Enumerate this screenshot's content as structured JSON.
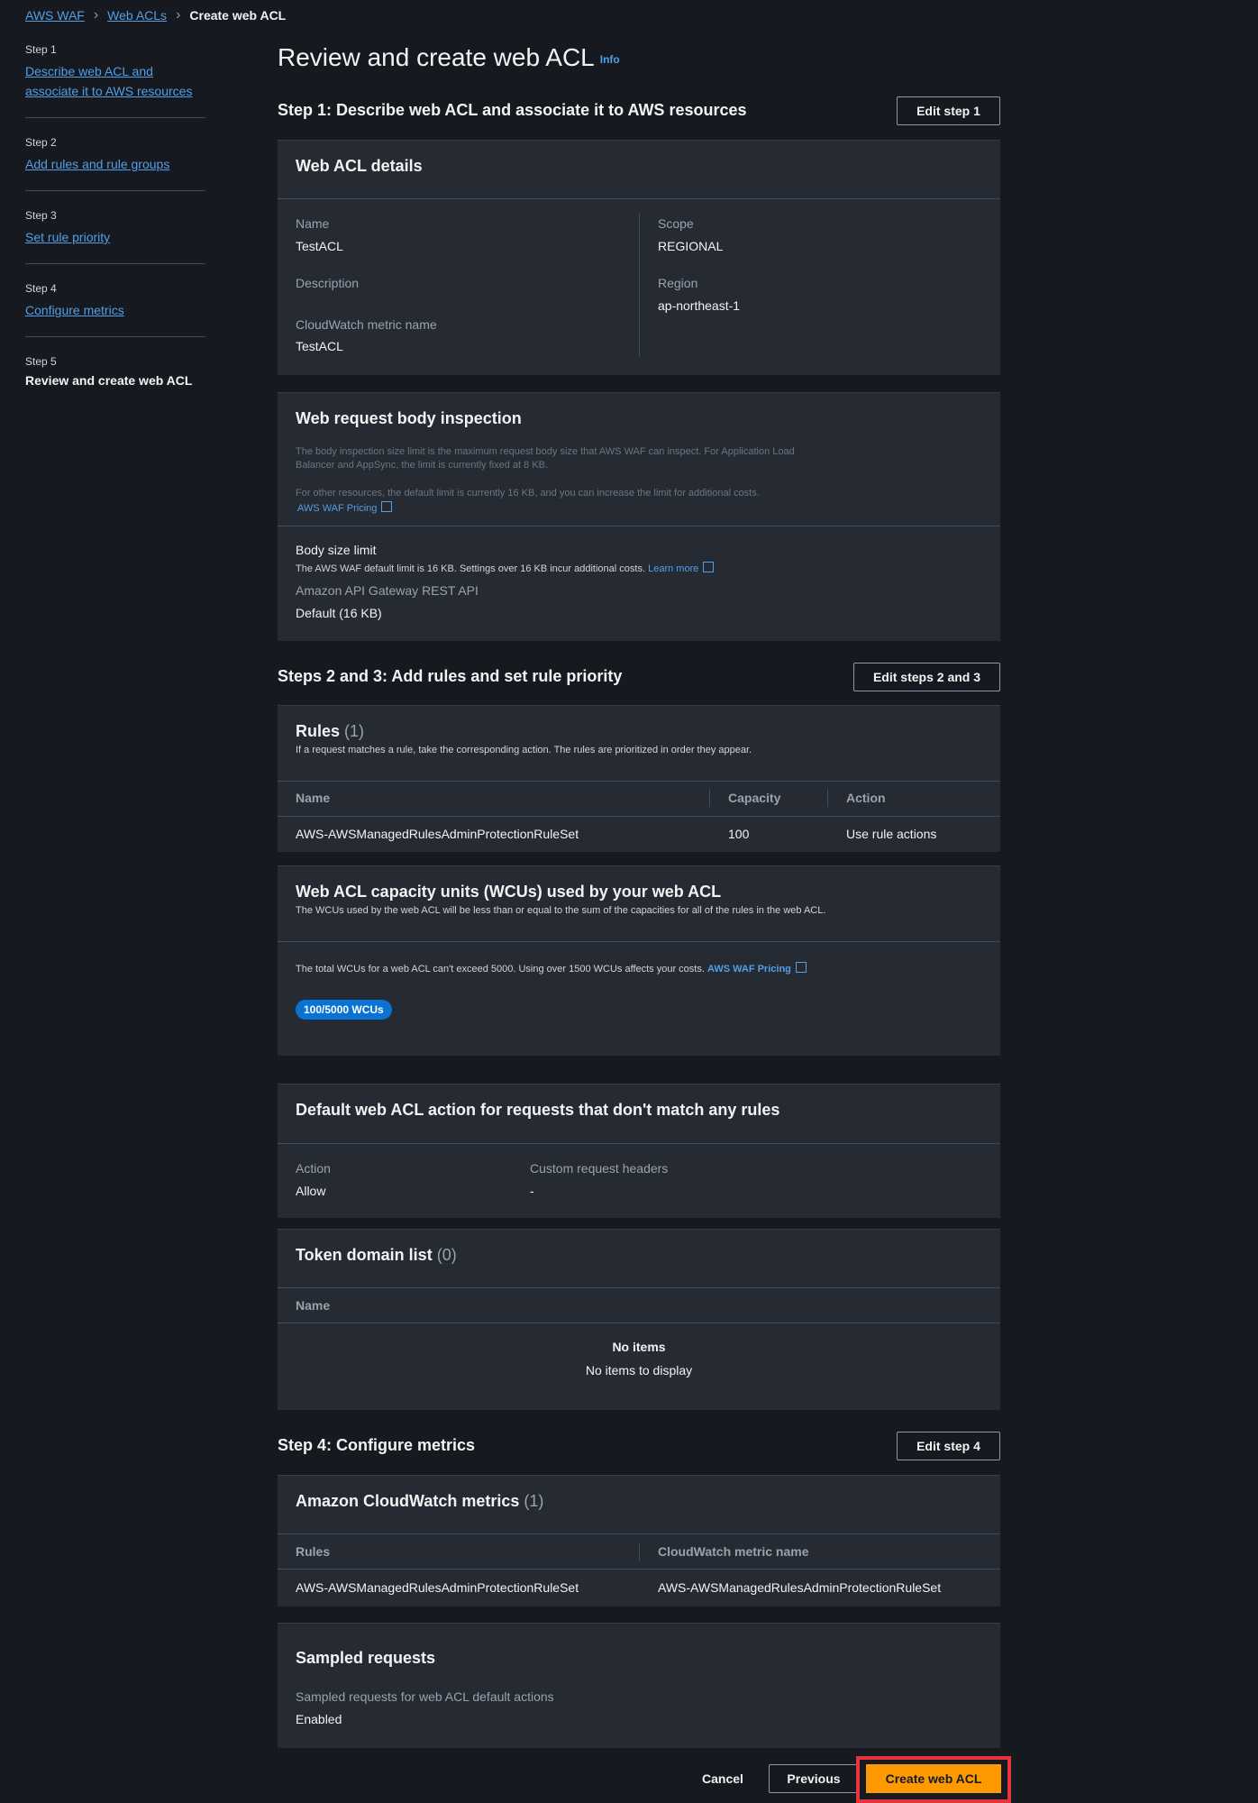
{
  "breadcrumb": {
    "items": [
      "AWS WAF",
      "Web ACLs"
    ],
    "current": "Create web ACL"
  },
  "nav": {
    "steps": [
      {
        "num": "Step 1",
        "label": "Describe web ACL and associate it to AWS resources"
      },
      {
        "num": "Step 2",
        "label": "Add rules and rule groups"
      },
      {
        "num": "Step 3",
        "label": "Set rule priority"
      },
      {
        "num": "Step 4",
        "label": "Configure metrics"
      },
      {
        "num": "Step 5",
        "label": "Review and create web ACL"
      }
    ]
  },
  "page": {
    "title": "Review and create web ACL",
    "info": "Info"
  },
  "step1": {
    "title": "Step 1: Describe web ACL and associate it to AWS resources",
    "edit_label": "Edit step 1",
    "details": {
      "title": "Web ACL details",
      "name_label": "Name",
      "name_value": "TestACL",
      "description_label": "Description",
      "metric_label": "CloudWatch metric name",
      "metric_value": "TestACL",
      "scope_label": "Scope",
      "scope_value": "REGIONAL",
      "region_label": "Region",
      "region_value": "ap-northeast-1"
    },
    "body": {
      "title": "Web request body inspection",
      "desc1": "The body inspection size limit is the maximum request body size that AWS WAF can inspect. For Application Load Balancer and AppSync, the limit is currently fixed at 8 KB.",
      "desc2": "For other resources, the default limit is currently 16 KB, and you can increase the limit for additional costs.",
      "pricing_link": "AWS WAF Pricing",
      "size_label": "Body size limit",
      "size_desc": "The AWS WAF default limit is 16 KB. Settings over 16 KB incur additional costs.",
      "learn_more": "Learn more",
      "api_label": "Amazon API Gateway REST API",
      "api_value": "Default (16 KB)"
    }
  },
  "steps23": {
    "title": "Steps 2 and 3: Add rules and set rule priority",
    "edit_label": "Edit steps 2 and 3",
    "rules": {
      "title": "Rules",
      "count": "(1)",
      "desc": "If a request matches a rule, take the corresponding action. The rules are prioritized in order they appear.",
      "columns": [
        "Name",
        "Capacity",
        "Action"
      ],
      "rows": [
        {
          "name": "AWS-AWSManagedRulesAdminProtectionRuleSet",
          "capacity": "100",
          "action": "Use rule actions"
        }
      ]
    },
    "wcu": {
      "title": "Web ACL capacity units (WCUs) used by your web ACL",
      "desc": "The WCUs used by the web ACL will be less than or equal to the sum of the capacities for all of the rules in the web ACL.",
      "note": "The total WCUs for a web ACL can't exceed 5000. Using over 1500 WCUs affects your costs.",
      "pricing_link": "AWS WAF Pricing",
      "badge": "100/5000 WCUs"
    },
    "default_action": {
      "title": "Default web ACL action for requests that don't match any rules",
      "action_label": "Action",
      "action_value": "Allow",
      "headers_label": "Custom request headers",
      "headers_value": "-"
    },
    "token": {
      "title": "Token domain list",
      "count": "(0)",
      "column": "Name",
      "empty_title": "No items",
      "empty_desc": "No items to display"
    }
  },
  "step4": {
    "title": "Step 4: Configure metrics",
    "edit_label": "Edit step 4",
    "metrics": {
      "title": "Amazon CloudWatch metrics",
      "count": "(1)",
      "columns": [
        "Rules",
        "CloudWatch metric name"
      ],
      "rows": [
        {
          "rule": "AWS-AWSManagedRulesAdminProtectionRuleSet",
          "metric": "AWS-AWSManagedRulesAdminProtectionRuleSet"
        }
      ]
    },
    "sampled": {
      "title": "Sampled requests",
      "label": "Sampled requests for web ACL default actions",
      "value": "Enabled"
    }
  },
  "footer": {
    "cancel": "Cancel",
    "previous": "Previous",
    "create": "Create web ACL"
  },
  "colors": {
    "background": "#16191f",
    "card": "#262b33",
    "link": "#539fe5",
    "primary": "#ff9900",
    "badge": "#0972d3",
    "highlight": "#e8333d"
  }
}
